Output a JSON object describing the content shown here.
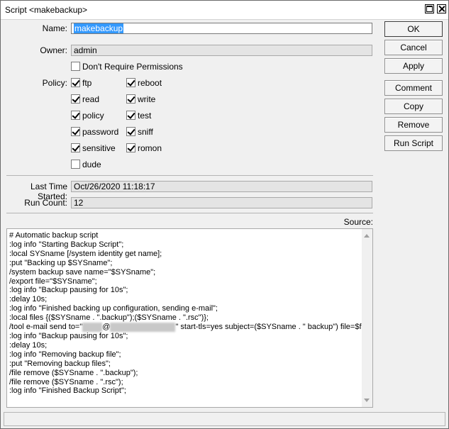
{
  "window": {
    "title": "Script <makebackup>"
  },
  "form": {
    "name_label": "Name:",
    "name_value": "makebackup",
    "owner_label": "Owner:",
    "owner_value": "admin",
    "dont_require_permissions": "Don't Require Permissions",
    "policy_label": "Policy:",
    "policies": [
      {
        "label": "ftp",
        "checked": true
      },
      {
        "label": "reboot",
        "checked": true
      },
      {
        "label": "read",
        "checked": true
      },
      {
        "label": "write",
        "checked": true
      },
      {
        "label": "policy",
        "checked": true
      },
      {
        "label": "test",
        "checked": true
      },
      {
        "label": "password",
        "checked": true
      },
      {
        "label": "sniff",
        "checked": true
      },
      {
        "label": "sensitive",
        "checked": true
      },
      {
        "label": "romon",
        "checked": true
      },
      {
        "label": "dude",
        "checked": false
      }
    ],
    "last_time_label": "Last Time Started:",
    "last_time_value": "Oct/26/2020 11:18:17",
    "run_count_label": "Run Count:",
    "run_count_value": "12",
    "source_label": "Source:"
  },
  "buttons": {
    "ok": "OK",
    "cancel": "Cancel",
    "apply": "Apply",
    "comment": "Comment",
    "copy": "Copy",
    "remove": "Remove",
    "run_script": "Run Script"
  },
  "source": {
    "lines": [
      "# Automatic backup script",
      ":log info \"Starting Backup Script\";",
      ":local SYSname [/system identity get name];",
      ":put \"Backing up $SYSname\";",
      "/system backup save name=\"$SYSname\";",
      "/export file=\"$SYSname\";",
      ":log info \"Backup pausing for 10s\";",
      ":delay 10s;",
      ":log info \"Finished backing up configuration, sending e-mail\";",
      ":local files {($SYSname . \".backup\");($SYSname . \".rsc\")};",
      "/tool e-mail send to=\"",
      ":log info \"Backup pausing for 10s\";",
      ":delay 10s;",
      ":log info \"Removing backup file\";",
      ":put \"Removing backup files\";",
      "/file remove ($SYSname . \".backup\");",
      "/file remove ($SYSname . \".rsc\");",
      ":log info \"Finished Backup Script\";"
    ],
    "email_suffix": "\" start-tls=yes subject=($SYSname . \" backup\") file=$files;"
  }
}
